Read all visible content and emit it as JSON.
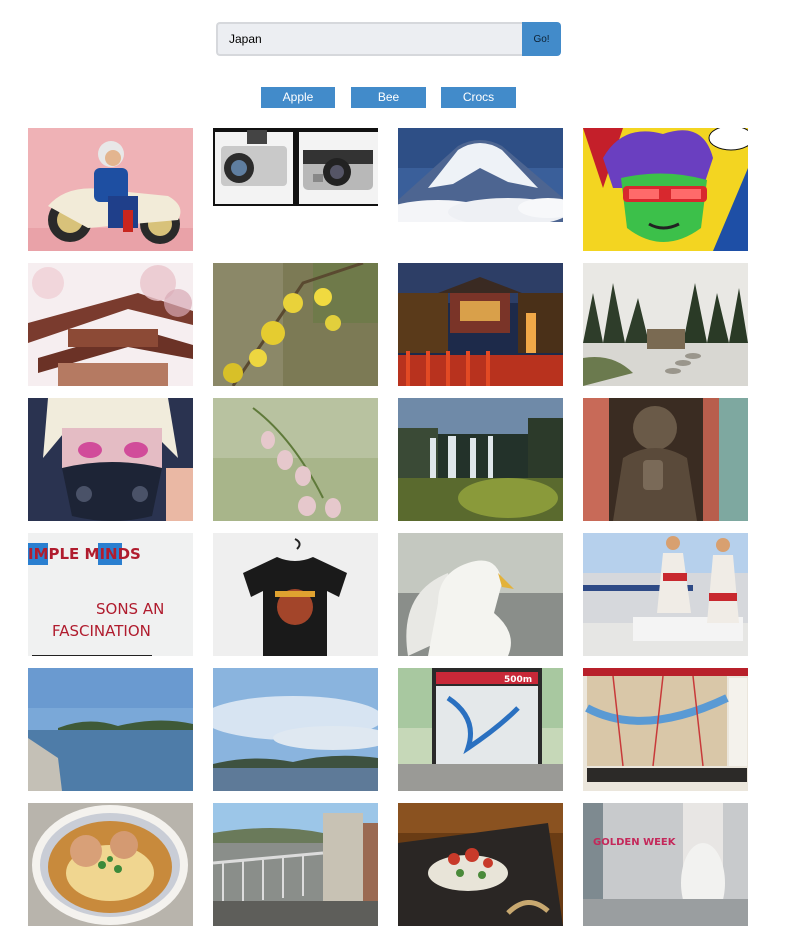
{
  "search": {
    "value": "Japan",
    "button_label": "Go!"
  },
  "quick_searches": [
    "Apple",
    "Bee",
    "Crocs"
  ],
  "thumbnail_text": {
    "band_line_1": "IMPLE   MINDS",
    "band_line_2": "SONS AN",
    "band_line_3": "FASCINATION",
    "map_sign": "500m",
    "shop_window": "GOLDEN WEEK"
  }
}
